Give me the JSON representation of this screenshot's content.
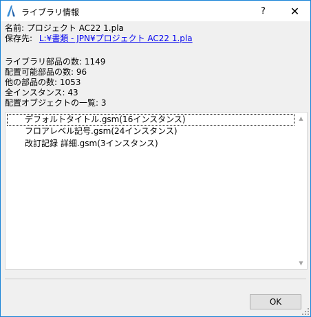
{
  "window": {
    "title": "ライブラリ情報",
    "help_label": "?",
    "close_label": "✕"
  },
  "info": {
    "name_label": "名前:",
    "name_value": "プロジェクト AC22 1.pla",
    "location_label": "保存先:",
    "location_value": "L:¥書類 - JPN¥プロジェクト AC22 1.pla",
    "library_parts": "ライブラリ部品の数: 1149",
    "placeable_parts": "配置可能部品の数: 96",
    "other_parts": "他の部品の数: 1053",
    "all_instances": "全インスタンス: 43",
    "placed_objects": "配置オブジェクトの一覧: 3"
  },
  "objects": [
    "デフォルトタイトル.gsm(16インスタンス)",
    "フロアレベル記号.gsm(24インスタンス)",
    "改訂記録 詳細.gsm(3インスタンス)"
  ],
  "ok_label": "OK"
}
